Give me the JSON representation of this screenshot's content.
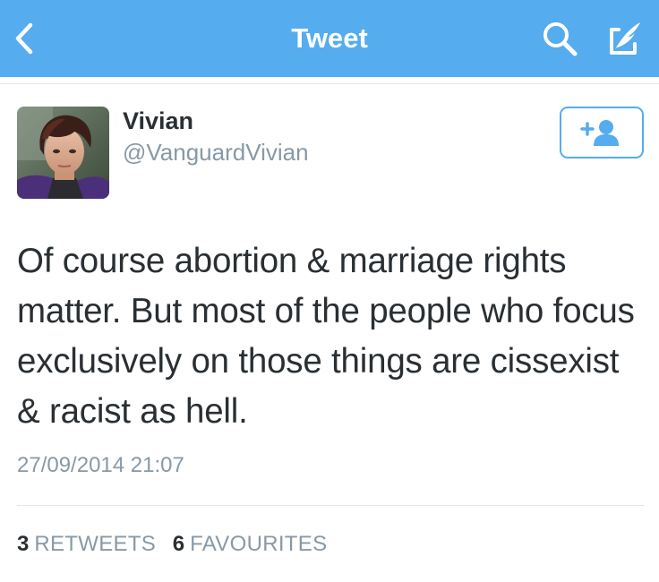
{
  "nav": {
    "title": "Tweet",
    "back_icon": "chevron-left-icon",
    "search_icon": "search-icon",
    "compose_icon": "compose-icon",
    "bar_color": "#55acee"
  },
  "tweet": {
    "author": {
      "display_name": "Vivian",
      "handle": "@VanguardVivian",
      "avatar": "avatar-photo"
    },
    "follow_button_icon": "add-user-icon",
    "text": "Of course abortion & marriage rights matter. But most of the people who focus exclusively on those things are cissexist & racist as hell.",
    "timestamp": "27/09/2014 21:07",
    "stats": {
      "retweets_count": "3",
      "retweets_label": "RETWEETS",
      "favourites_count": "6",
      "favourites_label": "FAVOURITES"
    }
  },
  "colors": {
    "accent": "#55acee",
    "text_primary": "#292f33",
    "text_secondary": "#8899a6",
    "divider": "#e1e8ed"
  }
}
